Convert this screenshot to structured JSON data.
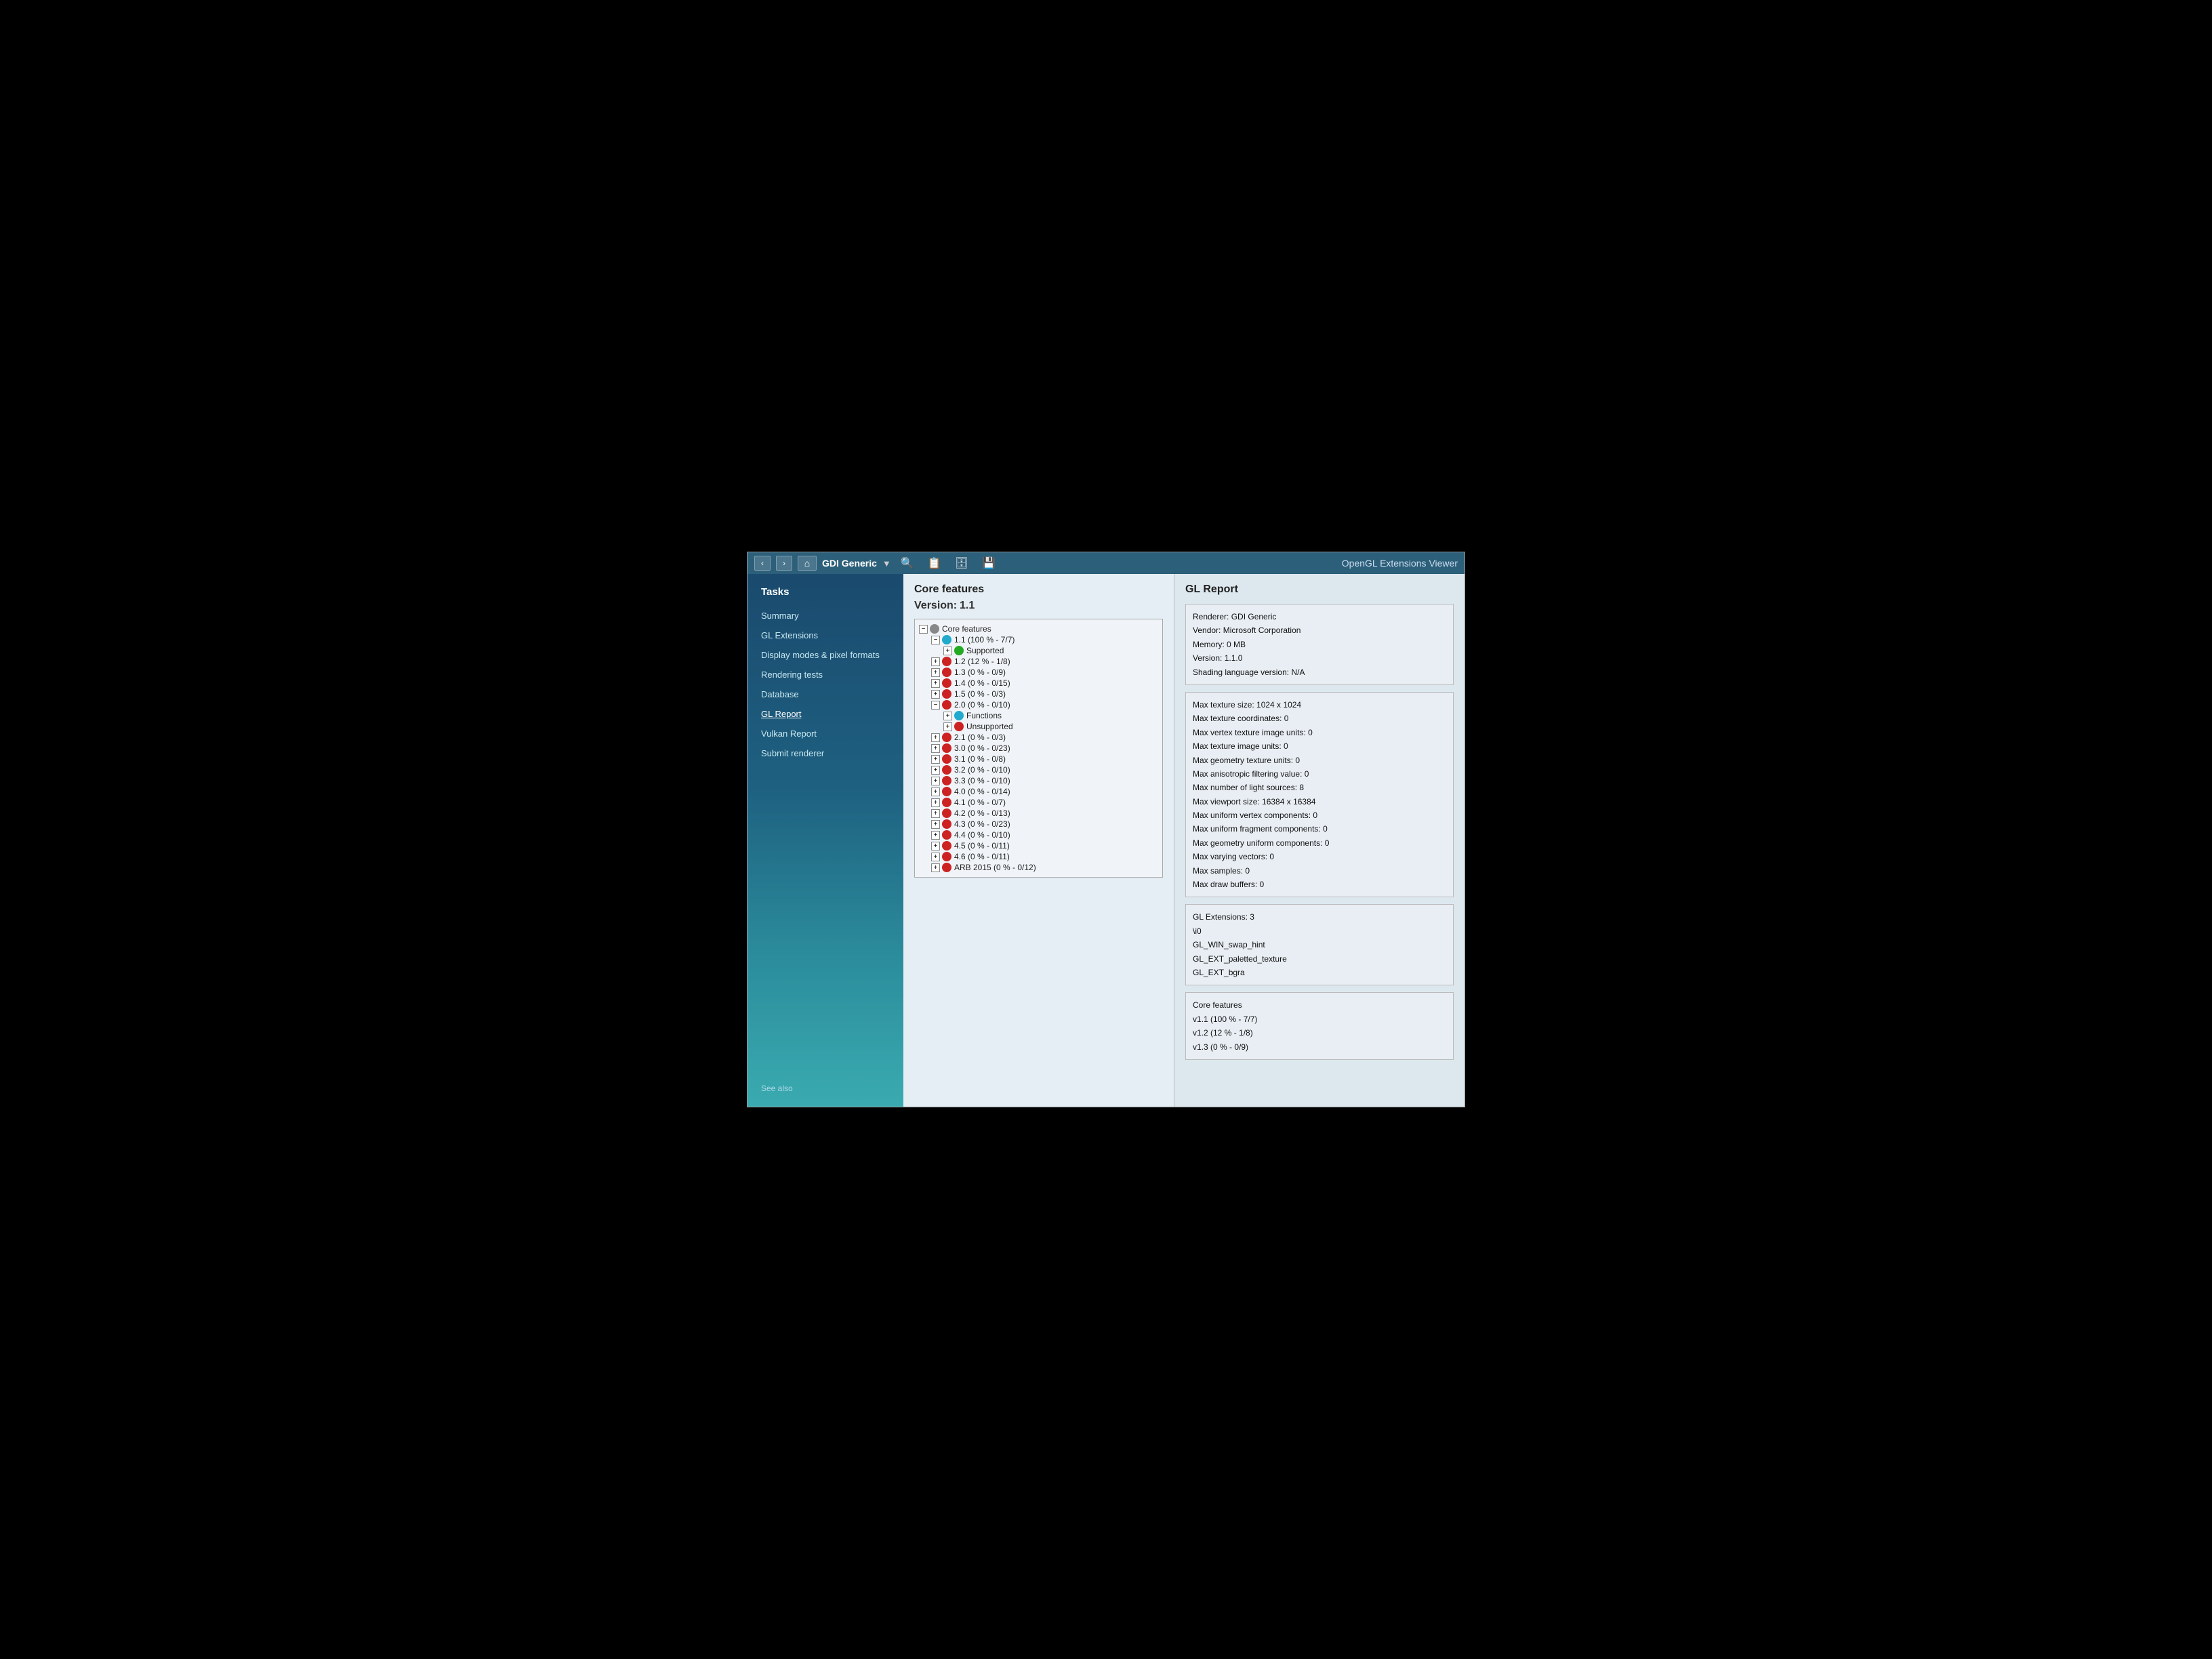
{
  "titleBar": {
    "rendererName": "GDI Generic",
    "windowTitle": "OpenGL Extensions Viewer",
    "navBack": "‹",
    "navForward": "›",
    "homeIcon": "⌂"
  },
  "sidebar": {
    "sectionTitle": "Tasks",
    "items": [
      {
        "label": "Summary",
        "active": false
      },
      {
        "label": "GL Extensions",
        "active": false
      },
      {
        "label": "Display modes & pixel formats",
        "active": false
      },
      {
        "label": "Rendering tests",
        "active": false
      },
      {
        "label": "Database",
        "active": false
      },
      {
        "label": "GL Report",
        "active": true
      },
      {
        "label": "Vulkan Report",
        "active": false
      },
      {
        "label": "Submit renderer",
        "active": false
      }
    ],
    "seeAlso": "See also"
  },
  "leftPanel": {
    "title": "Core features",
    "versionLabel": "Version:",
    "versionValue": "1.1",
    "treeItems": [
      {
        "indent": 0,
        "toggle": "-",
        "icon": "settings",
        "label": "Core features",
        "expand": true
      },
      {
        "indent": 1,
        "toggle": "-",
        "icon": "teal",
        "label": "1.1 (100 % - 7/7)",
        "expand": true
      },
      {
        "indent": 2,
        "toggle": "+",
        "icon": "green",
        "label": "Supported",
        "expand": false
      },
      {
        "indent": 1,
        "toggle": "+",
        "icon": "red",
        "label": "1.2 (12 % - 1/8)",
        "expand": false
      },
      {
        "indent": 1,
        "toggle": "+",
        "icon": "red",
        "label": "1.3 (0 % - 0/9)",
        "expand": false
      },
      {
        "indent": 1,
        "toggle": "+",
        "icon": "red",
        "label": "1.4 (0 % - 0/15)",
        "expand": false
      },
      {
        "indent": 1,
        "toggle": "+",
        "icon": "red",
        "label": "1.5 (0 % - 0/3)",
        "expand": false
      },
      {
        "indent": 1,
        "toggle": "-",
        "icon": "red",
        "label": "2.0 (0 % - 0/10)",
        "expand": true
      },
      {
        "indent": 2,
        "toggle": "+",
        "icon": "teal",
        "label": "Functions",
        "expand": false
      },
      {
        "indent": 2,
        "toggle": "+",
        "icon": "red",
        "label": "Unsupported",
        "expand": false
      },
      {
        "indent": 1,
        "toggle": "+",
        "icon": "red",
        "label": "2.1 (0 % - 0/3)",
        "expand": false
      },
      {
        "indent": 1,
        "toggle": "+",
        "icon": "red",
        "label": "3.0 (0 % - 0/23)",
        "expand": false
      },
      {
        "indent": 1,
        "toggle": "+",
        "icon": "red",
        "label": "3.1 (0 % - 0/8)",
        "expand": false
      },
      {
        "indent": 1,
        "toggle": "+",
        "icon": "red",
        "label": "3.2 (0 % - 0/10)",
        "expand": false
      },
      {
        "indent": 1,
        "toggle": "+",
        "icon": "red",
        "label": "3.3 (0 % - 0/10)",
        "expand": false
      },
      {
        "indent": 1,
        "toggle": "+",
        "icon": "red",
        "label": "4.0 (0 % - 0/14)",
        "expand": false
      },
      {
        "indent": 1,
        "toggle": "+",
        "icon": "red",
        "label": "4.1 (0 % - 0/7)",
        "expand": false
      },
      {
        "indent": 1,
        "toggle": "+",
        "icon": "red",
        "label": "4.2 (0 % - 0/13)",
        "expand": false
      },
      {
        "indent": 1,
        "toggle": "+",
        "icon": "red",
        "label": "4.3 (0 % - 0/23)",
        "expand": false
      },
      {
        "indent": 1,
        "toggle": "+",
        "icon": "red",
        "label": "4.4 (0 % - 0/10)",
        "expand": false
      },
      {
        "indent": 1,
        "toggle": "+",
        "icon": "red",
        "label": "4.5 (0 % - 0/11)",
        "expand": false
      },
      {
        "indent": 1,
        "toggle": "+",
        "icon": "red",
        "label": "4.6 (0 % - 0/11)",
        "expand": false
      },
      {
        "indent": 1,
        "toggle": "+",
        "icon": "red",
        "label": "ARB 2015 (0 % - 0/12)",
        "expand": false
      }
    ]
  },
  "rightPanel": {
    "title": "GL Report",
    "rendererInfo": {
      "renderer": "Renderer: GDI Generic",
      "vendor": "Vendor: Microsoft Corporation",
      "memory": "Memory: 0 MB",
      "version": "Version: 1.1.0",
      "shadingLang": "Shading language version: N/A"
    },
    "textureInfo": {
      "maxTextureSize": "Max texture size: 1024 x 1024",
      "maxTextureCoords": "Max texture coordinates: 0",
      "maxVertexTextureImageUnits": "Max vertex texture image units: 0",
      "maxTextureImageUnits": "Max texture image units: 0",
      "maxGeometryTextureUnits": "Max geometry texture units: 0",
      "maxAnisotropic": "Max anisotropic filtering value: 0",
      "maxLightSources": "Max number of light sources: 8",
      "maxViewportSize": "Max viewport size: 16384 x 16384",
      "maxUniformVertex": "Max uniform vertex components: 0",
      "maxUniformFragment": "Max uniform fragment components: 0",
      "maxUniformGeometry": "Max geometry uniform components: 0",
      "maxVaryingVectors": "Max varying vectors: 0",
      "maxSamples": "Max samples: 0",
      "maxDrawBuffers": "Max draw buffers: 0"
    },
    "extensionsInfo": {
      "count": "GL Extensions: 3",
      "list": "\\i0",
      "extensions": [
        "GL_WIN_swap_hint",
        "GL_EXT_paletted_texture",
        "GL_EXT_bgra"
      ]
    },
    "coreFeatures": {
      "label": "Core features",
      "v11": "v1.1 (100 % - 7/7)",
      "v12": "v1.2 (12 % - 1/8)",
      "v13": "v1.3 (0 % - 0/9)"
    }
  }
}
